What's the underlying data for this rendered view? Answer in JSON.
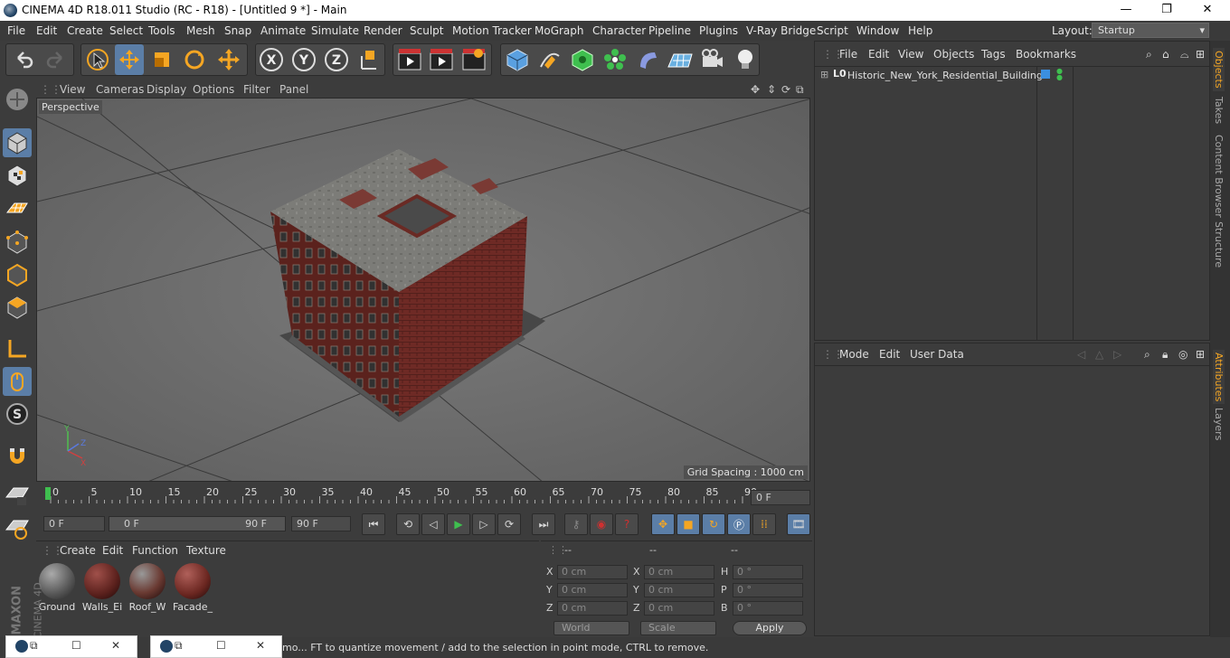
{
  "window": {
    "title": "CINEMA 4D R18.011 Studio (RC - R18) - [Untitled 9 *] - Main",
    "minimize": "—",
    "maximize": "❐",
    "close": "✕"
  },
  "menubar": {
    "items": [
      "File",
      "Edit",
      "Create",
      "Select",
      "Tools",
      "Mesh",
      "Snap",
      "Animate",
      "Simulate",
      "Render",
      "Sculpt",
      "Motion Tracker",
      "MoGraph",
      "Character",
      "Pipeline",
      "Plugins",
      "V-Ray Bridge",
      "Script",
      "Window",
      "Help"
    ],
    "layout_label": "Layout:",
    "layout_value": "Startup"
  },
  "viewport": {
    "menu": [
      "View",
      "Cameras",
      "Display",
      "Options",
      "Filter",
      "Panel"
    ],
    "camera_label": "Perspective",
    "grid_spacing": "Grid Spacing : 1000 cm"
  },
  "timeline": {
    "ticks": [
      "0",
      "5",
      "10",
      "15",
      "20",
      "25",
      "30",
      "35",
      "40",
      "45",
      "50",
      "55",
      "60",
      "65",
      "70",
      "75",
      "80",
      "85",
      "90"
    ],
    "current_frame": "0 F",
    "start_field": "0 F",
    "range_start": "0 F",
    "range_end": "90 F",
    "end_field": "90 F"
  },
  "materials": {
    "menu": [
      "Create",
      "Edit",
      "Function",
      "Texture"
    ],
    "items": [
      {
        "label": "Ground",
        "color": "#6a6a6a"
      },
      {
        "label": "Walls_Ei",
        "color": "#6b2a24"
      },
      {
        "label": "Roof_W",
        "color": "#5a3a32"
      },
      {
        "label": "Facade_",
        "color": "#7a3028"
      }
    ]
  },
  "coordinates": {
    "header": [
      "--",
      "--",
      "--"
    ],
    "rows": [
      {
        "a": "X",
        "av": "0 cm",
        "b": "X",
        "bv": "0 cm",
        "c": "H",
        "cv": "0 °"
      },
      {
        "a": "Y",
        "av": "0 cm",
        "b": "Y",
        "bv": "0 cm",
        "c": "P",
        "cv": "0 °"
      },
      {
        "a": "Z",
        "av": "0 cm",
        "b": "Z",
        "bv": "0 cm",
        "c": "B",
        "cv": "0 °"
      }
    ],
    "space": "World",
    "mode": "Scale",
    "apply": "Apply"
  },
  "object_manager": {
    "menu": [
      "File",
      "Edit",
      "View",
      "Objects",
      "Tags",
      "Bookmarks"
    ],
    "objects": [
      {
        "name": "Historic_New_York_Residential_Building"
      }
    ]
  },
  "attribute_manager": {
    "menu": [
      "Mode",
      "Edit",
      "User Data"
    ]
  },
  "side_tabs": [
    "Objects",
    "Takes",
    "Content Browser",
    "Structure",
    "Attributes",
    "Layers"
  ],
  "status": {
    "text": "mo... FT to quantize movement / add to the selection in point mode, CTRL to remove."
  },
  "brand": {
    "maxon": "MAXON",
    "product": "CINEMA 4D"
  },
  "colors": {
    "accent": "#5b7ea7",
    "panel": "#3c3c3c",
    "viewport": "#6b6b6b"
  }
}
